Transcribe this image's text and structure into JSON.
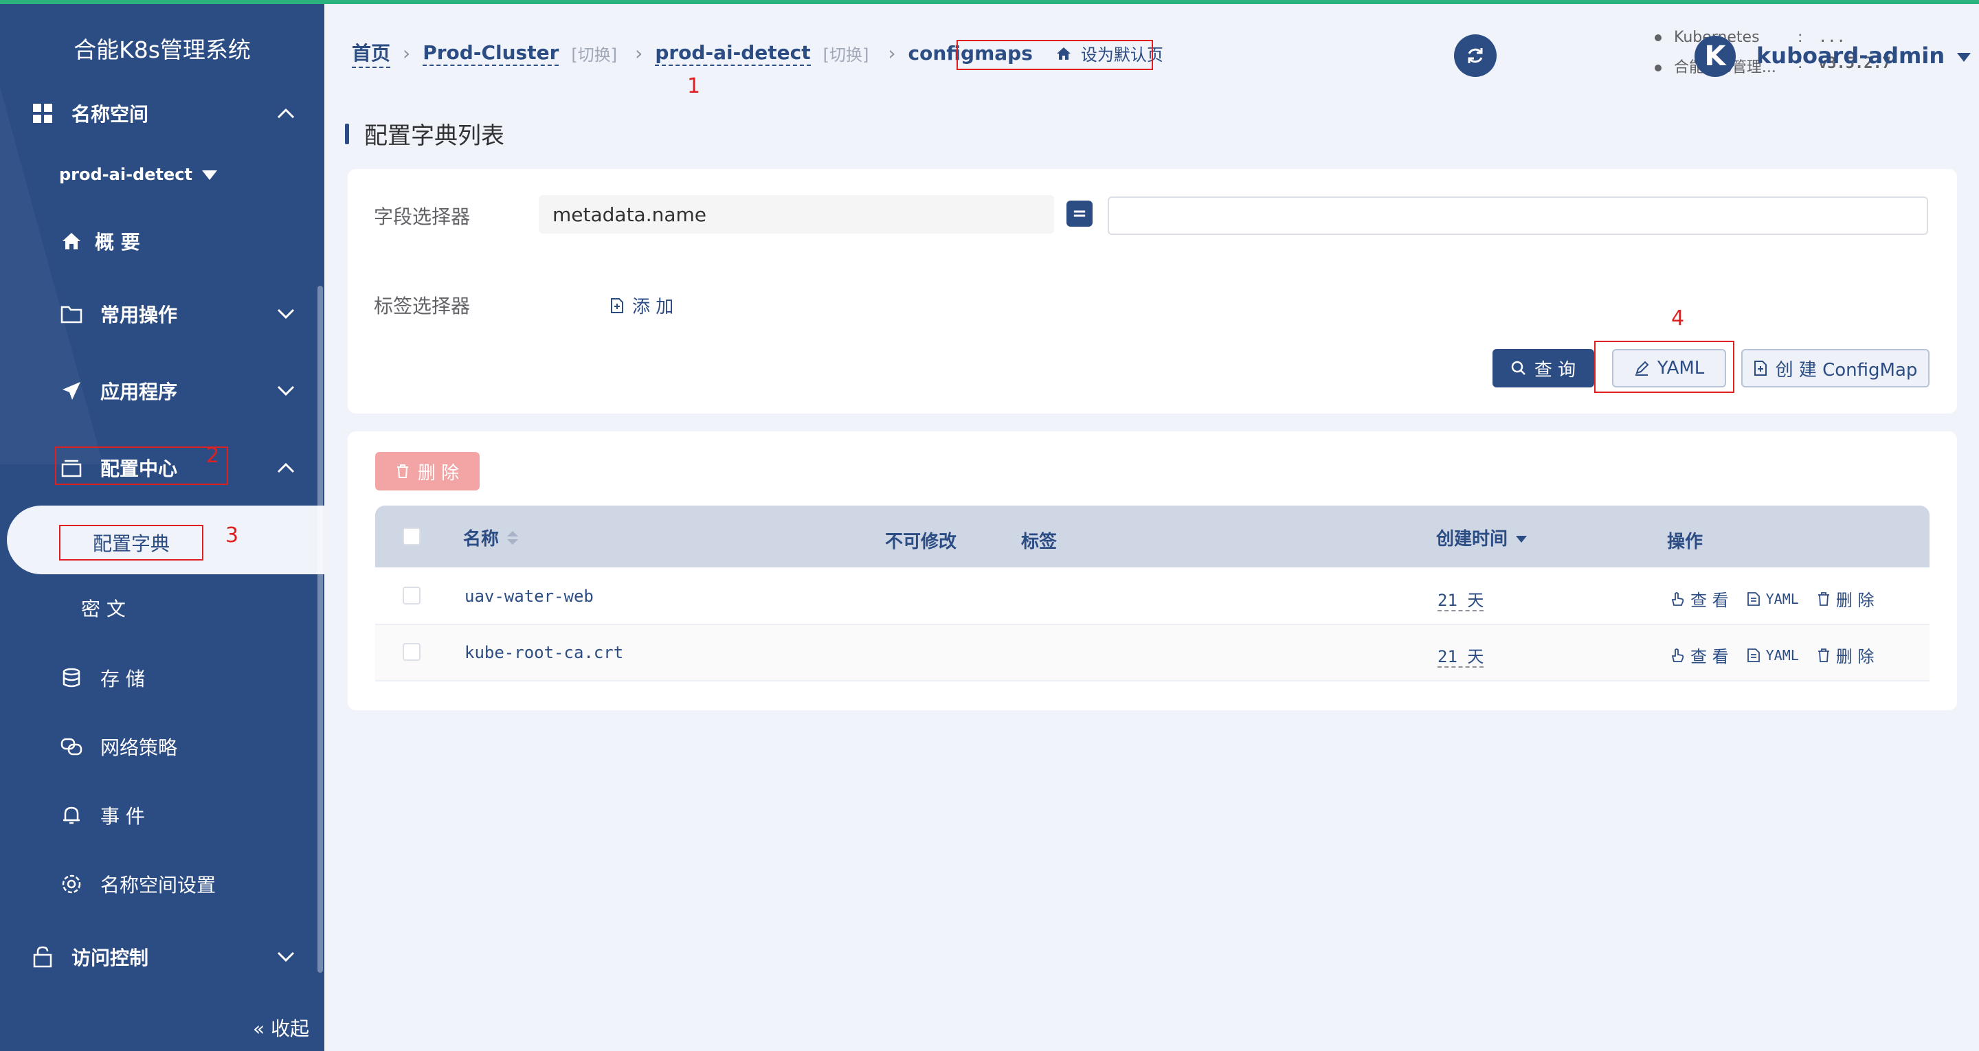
{
  "app": {
    "title": "合能K8s管理系统",
    "accent_color": "#2c4c84",
    "top_bar_color": "#2bb37f"
  },
  "sidebar": {
    "namespace_section": "名称空间",
    "namespace_selector": "prod-ai-detect",
    "overview": "概 要",
    "common_ops": "常用操作",
    "apps": "应用程序",
    "config_center": "配置中心",
    "configmap": "配置字典",
    "secret": "密 文",
    "storage": "存 储",
    "network_policy": "网络策略",
    "events": "事 件",
    "ns_settings": "名称空间设置",
    "access_control": "访问控制",
    "collapse": "收起"
  },
  "breadcrumb": {
    "home": "首页",
    "cluster": "Prod-Cluster",
    "cluster_switch": "[切换]",
    "namespace": "prod-ai-detect",
    "namespace_switch": "[切换]",
    "resource": "configmaps",
    "set_default": "设为默认页"
  },
  "kube_info": {
    "k8s_label": "Kubernetes",
    "k8s_value": "...",
    "sys_label": "合能K8s管理...",
    "sys_value": "v3.5.2.7",
    "colon": ":"
  },
  "user": {
    "avatar_letter": "K",
    "name": "kuboard-admin"
  },
  "page": {
    "title": "配置字典列表"
  },
  "filter": {
    "field_selector_label": "字段选择器",
    "field_name": "metadata.name",
    "operator": "=",
    "field_value": "",
    "label_selector_label": "标签选择器",
    "add_label": "添 加",
    "query_button": "查 询",
    "yaml_button": "YAML",
    "create_button": "创 建 ConfigMap"
  },
  "table": {
    "delete_button": "删 除",
    "columns": {
      "name": "名称",
      "immutable": "不可修改",
      "labels": "标签",
      "created": "创建时间",
      "actions": "操作"
    },
    "rows": [
      {
        "name": "uav-water-web",
        "created": "21 天"
      },
      {
        "name": "kube-root-ca.crt",
        "created": "21 天"
      }
    ],
    "actions": {
      "view": "查 看",
      "yaml": "YAML",
      "delete": "删 除"
    }
  },
  "annotations": {
    "n1": "1",
    "n2": "2",
    "n3": "3",
    "n4": "4"
  }
}
